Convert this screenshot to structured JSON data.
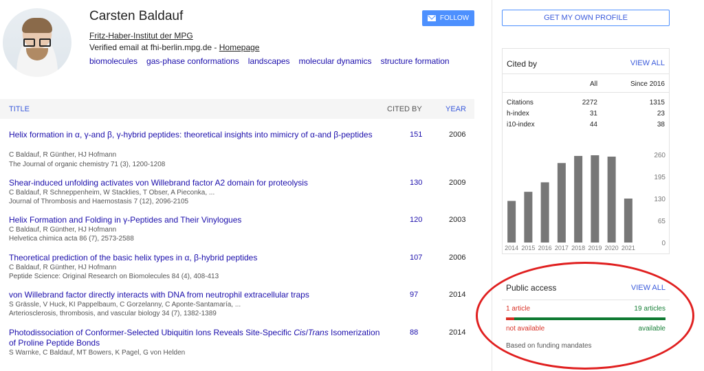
{
  "profile": {
    "name": "Carsten Baldauf",
    "affiliation": "Fritz-Haber-Institut der MPG",
    "verified_text": "Verified email at fhi-berlin.mpg.de - ",
    "homepage_label": "Homepage",
    "interests": [
      "biomolecules",
      "gas-phase conformations",
      "landscapes",
      "molecular dynamics",
      "structure formation"
    ],
    "follow_label": "FOLLOW"
  },
  "table": {
    "col_title": "TITLE",
    "col_cited": "CITED BY",
    "col_year": "YEAR",
    "rows": [
      {
        "title": "Helix formation in α, γ-and β, γ-hybrid peptides: theoretical insights into mimicry of α-and β-peptides",
        "authors": "C Baldauf, R Günther, HJ Hofmann",
        "venue": "The Journal of organic chemistry 71 (3), 1200-1208",
        "cited": "151",
        "year": "2006"
      },
      {
        "title": "Shear-induced unfolding activates von Willebrand factor A2 domain for proteolysis",
        "authors": "C Baldauf, R Schneppenheim, W Stacklies, T Obser, A Pieconka, ...",
        "venue": "Journal of Thrombosis and Haemostasis 7 (12), 2096-2105",
        "cited": "130",
        "year": "2009"
      },
      {
        "title": "Helix Formation and Folding in γ-Peptides and Their Vinylogues",
        "authors": "C Baldauf, R Günther, HJ Hofmann",
        "venue": "Helvetica chimica acta 86 (7), 2573-2588",
        "cited": "120",
        "year": "2003"
      },
      {
        "title": "Theoretical prediction of the basic helix types in α, β-hybrid peptides",
        "authors": "C Baldauf, R Günther, HJ Hofmann",
        "venue": "Peptide Science: Original Research on Biomolecules 84 (4), 408-413",
        "cited": "107",
        "year": "2006"
      },
      {
        "title": "von Willebrand factor directly interacts with DNA from neutrophil extracellular traps",
        "authors": "S Grässle, V Huck, KI Pappelbaum, C Gorzelanny, C Aponte-Santamaría, ...",
        "venue": "Arteriosclerosis, thrombosis, and vascular biology 34 (7), 1382-1389",
        "cited": "97",
        "year": "2014"
      },
      {
        "title": "Photodissociation of Conformer-Selected Ubiquitin Ions Reveals Site-Specific Cis/Trans Isomerization of Proline Peptide Bonds",
        "authors": "S Warnke, C Baldauf, MT Bowers, K Pagel, G von Helden",
        "venue": "",
        "cited": "88",
        "year": "2014"
      }
    ]
  },
  "sidebar": {
    "own_profile_label": "GET MY OWN PROFILE",
    "cited_by": {
      "title": "Cited by",
      "view_all": "VIEW ALL",
      "col_all": "All",
      "col_since": "Since 2016",
      "metrics": [
        {
          "label": "Citations",
          "all": "2272",
          "since": "1315"
        },
        {
          "label": "h-index",
          "all": "31",
          "since": "23"
        },
        {
          "label": "i10-index",
          "all": "44",
          "since": "38"
        }
      ]
    },
    "public_access": {
      "title": "Public access",
      "view_all": "VIEW ALL",
      "not_available_count": "1 article",
      "available_count": "19 articles",
      "not_available_label": "not available",
      "available_label": "available",
      "mandate_note": "Based on funding mandates",
      "not_available_fraction": 0.05
    }
  },
  "chart_data": {
    "type": "bar",
    "categories": [
      "2014",
      "2015",
      "2016",
      "2017",
      "2018",
      "2019",
      "2020",
      "2021"
    ],
    "values": [
      123,
      150,
      178,
      235,
      256,
      258,
      254,
      130
    ],
    "ylim": [
      0,
      260
    ],
    "yticks": [
      "260",
      "195",
      "130",
      "65",
      "0"
    ],
    "bar_color": "#777777"
  },
  "colors": {
    "link": "#1a0dab",
    "accent": "#4d90fe",
    "not_available": "#d93025",
    "available": "#188038",
    "annotation": "#e02020"
  }
}
